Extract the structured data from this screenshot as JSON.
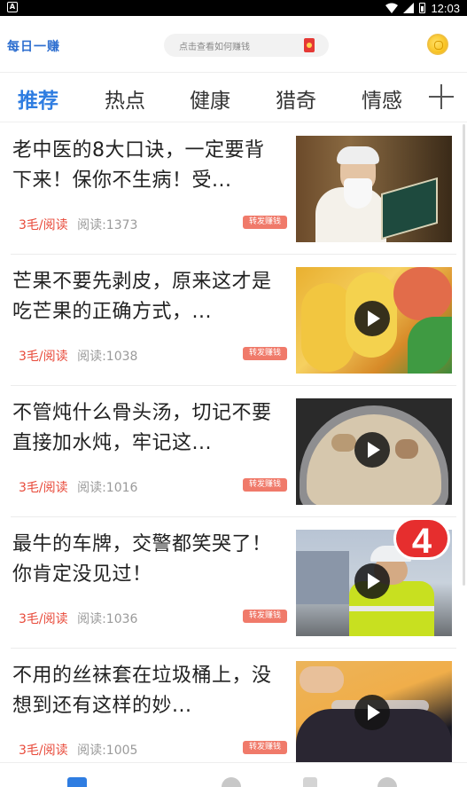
{
  "status_bar": {
    "time": "12:03",
    "notification_icon": "app-notification-icon",
    "wifi_icon": "wifi-icon",
    "signal_icon": "signal-icon",
    "battery_icon": "battery-icon"
  },
  "header": {
    "app_name": "每日一赚",
    "search_placeholder": "点击查看如何赚钱",
    "search_icon": "red-packet-icon",
    "coin_icon": "gold-coin-icon",
    "accent_color": "#2f7de1"
  },
  "tabs": {
    "items": [
      {
        "label": "推荐",
        "active": true
      },
      {
        "label": "热点",
        "active": false
      },
      {
        "label": "健康",
        "active": false
      },
      {
        "label": "猎奇",
        "active": false
      },
      {
        "label": "情感",
        "active": false
      }
    ],
    "add_icon": "plus-icon"
  },
  "feed": {
    "share_label": "转发赚钱",
    "items": [
      {
        "title": "老中医的8大口诀，一定要背下来！保你不生病！受...",
        "rate": "3毛/阅读",
        "views": "阅读:1373",
        "thumbnail": "elder-reading-book",
        "has_video": false
      },
      {
        "title": "芒果不要先剥皮，原来这才是吃芒果的正确方式，...",
        "rate": "3毛/阅读",
        "views": "阅读:1038",
        "thumbnail": "mangoes",
        "has_video": true
      },
      {
        "title": "不管炖什么骨头汤，切记不要直接加水炖，牢记这...",
        "rate": "3毛/阅读",
        "views": "阅读:1016",
        "thumbnail": "bone-soup-pot",
        "has_video": true
      },
      {
        "title": "最牛的车牌，交警都笑哭了！你肯定没见过！",
        "rate": "3毛/阅读",
        "views": "阅读:1036",
        "thumbnail": "traffic-police",
        "has_video": true,
        "badge": "4"
      },
      {
        "title": "不用的丝袜套在垃圾桶上，没想到还有这样的妙...",
        "rate": "3毛/阅读",
        "views": "阅读:1005",
        "thumbnail": "trash-bag",
        "has_video": true
      }
    ]
  },
  "bottom_nav": {
    "icons": [
      "home-icon",
      "video-icon",
      "task-icon",
      "profile-icon"
    ]
  }
}
